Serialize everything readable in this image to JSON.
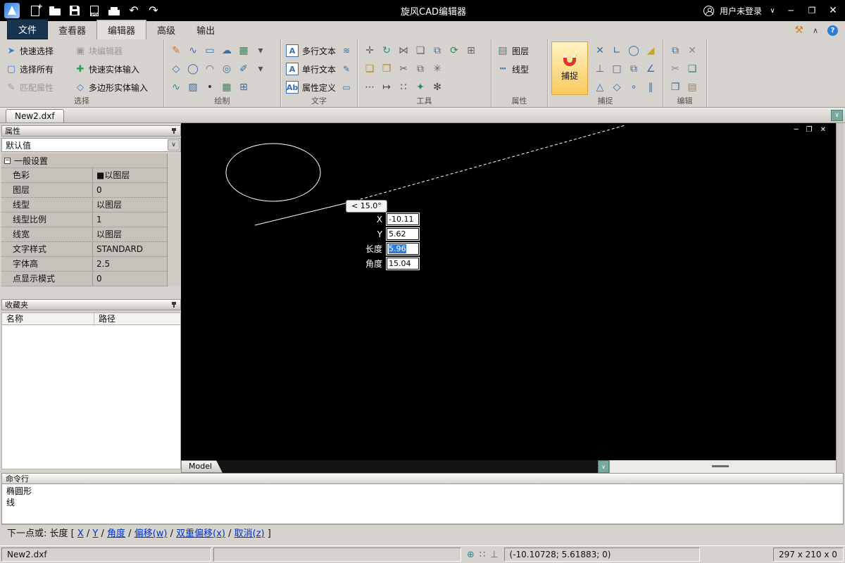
{
  "colors": {
    "titlebar_bg": "#000000",
    "chrome_bg": "#d6d3ce",
    "canvas_bg": "#000000",
    "snap_active_bg": "#fbe28a",
    "snap_active_border": "#e0a33e",
    "selection_highlight": "#2f7bd9",
    "command_link": "#0033cc",
    "file_tab_bg": "#17334e"
  },
  "glyphs": {
    "minimize": "─",
    "restore": "❐",
    "close": "✕",
    "chevron_down": "∨",
    "chevron_up": "∧",
    "undo": "↶",
    "redo": "↷",
    "plus": "+",
    "pdf": "PDF",
    "help": "?",
    "wrench": "⚒",
    "status_zoom": "⊕",
    "status_grid": "∷",
    "status_ortho": "⊥",
    "collapse_box": "−",
    "check": "✓"
  },
  "titlebar": {
    "title": "旋风CAD编辑器",
    "user_label": "用户未登录"
  },
  "menubar": {
    "tabs": [
      {
        "label": "文件"
      },
      {
        "label": "查看器"
      },
      {
        "label": "编辑器"
      },
      {
        "label": "高级"
      },
      {
        "label": "输出"
      }
    ]
  },
  "ribbon": {
    "selection": {
      "label": "选择",
      "buttons": [
        {
          "name": "quick-select-button",
          "glyph": "➤",
          "color": "#3a7bd5",
          "label": "快速选择"
        },
        {
          "name": "select-all-button",
          "glyph": "▢",
          "color": "#3a7bd5",
          "label": "选择所有"
        },
        {
          "name": "match-properties-button",
          "glyph": "✎",
          "color": "#9a9a9a",
          "label": "匹配属性",
          "disabled": true
        },
        {
          "name": "block-editor-button",
          "glyph": "▣",
          "color": "#9a9a9a",
          "label": "块编辑器",
          "disabled": true
        },
        {
          "name": "quick-entity-input-button",
          "glyph": "✚",
          "color": "#2e9e4f",
          "label": "快速实体输入"
        },
        {
          "name": "polygon-entity-input-button",
          "glyph": "◇",
          "color": "#3a7bd5",
          "label": "多边形实体输入"
        }
      ]
    },
    "draw": {
      "label": "绘制",
      "rows": [
        [
          {
            "name": "line-icon",
            "glyph": "✎",
            "color": "#c77b2f"
          },
          {
            "name": "polyline-icon",
            "glyph": "∿",
            "color": "#3a6ea5"
          },
          {
            "name": "rectangle-icon",
            "glyph": "▭",
            "color": "#3a6ea5"
          },
          {
            "name": "revcloud-icon",
            "glyph": "☁",
            "color": "#3a6ea5"
          },
          {
            "name": "insert-block-icon",
            "glyph": "▦",
            "color": "#2e8b57"
          },
          {
            "name": "draw-more-icon",
            "glyph": "▾",
            "color": "#555555"
          }
        ],
        [
          {
            "name": "polygon-icon",
            "glyph": "◇",
            "color": "#3a6ea5"
          },
          {
            "name": "circle-icon",
            "glyph": "◯",
            "color": "#3a6ea5"
          },
          {
            "name": "arc-icon",
            "glyph": "◠",
            "color": "#3a6ea5"
          },
          {
            "name": "donut-icon",
            "glyph": "◎",
            "color": "#3a6ea5"
          },
          {
            "name": "sketch-icon",
            "glyph": "✐",
            "color": "#3a6ea5"
          },
          {
            "name": "draw-options-icon",
            "glyph": "▾",
            "color": "#555555"
          }
        ],
        [
          {
            "name": "spline-icon",
            "glyph": "∿",
            "color": "#2e8b8b"
          },
          {
            "name": "hatch-icon",
            "glyph": "▨",
            "color": "#3a6ea5"
          },
          {
            "name": "point-icon",
            "glyph": "•",
            "color": "#333333"
          },
          {
            "name": "table-icon",
            "glyph": "▦",
            "color": "#2e8b57"
          },
          {
            "name": "grid-icon",
            "glyph": "⊞",
            "color": "#3a6ea5"
          }
        ]
      ]
    },
    "text": {
      "label": "文字",
      "buttons": [
        {
          "name": "mtext-button",
          "glyph": "A",
          "label": "多行文本"
        },
        {
          "name": "single-text-button",
          "glyph": "A",
          "label": "单行文本"
        },
        {
          "name": "attribute-define-button",
          "glyph": "Ab",
          "label": "属性定义"
        }
      ],
      "mini": [
        {
          "name": "text-flow-icon",
          "glyph": "≋"
        },
        {
          "name": "text-edit-icon",
          "glyph": "✎"
        },
        {
          "name": "text-box-icon",
          "glyph": "▭"
        }
      ]
    },
    "tools": {
      "label": "工具",
      "rows": [
        [
          {
            "name": "move-icon",
            "glyph": "✛",
            "color": "#666666"
          },
          {
            "name": "rotate-icon",
            "glyph": "↻",
            "color": "#2e8b8b"
          },
          {
            "name": "mirror-icon",
            "glyph": "⋈",
            "color": "#666666"
          },
          {
            "name": "draworder-icon",
            "glyph": "❏",
            "color": "#666666"
          },
          {
            "name": "copy-entity-icon",
            "glyph": "⧉",
            "color": "#3a6ea5"
          },
          {
            "name": "rotate-copy-icon",
            "glyph": "⟳",
            "color": "#2e8b57"
          },
          {
            "name": "array-icon",
            "glyph": "⊞",
            "color": "#666666"
          }
        ],
        [
          {
            "name": "make-group-icon",
            "glyph": "❏",
            "color": "#b8860b"
          },
          {
            "name": "open-group-icon",
            "glyph": "❐",
            "color": "#b8860b"
          },
          {
            "name": "cut-entity-icon",
            "glyph": "✂",
            "color": "#666666"
          },
          {
            "name": "duplicate-icon",
            "glyph": "⧉",
            "color": "#666666"
          },
          {
            "name": "explode-icon",
            "glyph": "✳",
            "color": "#666666"
          }
        ],
        [
          {
            "name": "more-tools-icon",
            "glyph": "⋯",
            "color": "#444444"
          },
          {
            "name": "measure-icon",
            "glyph": "↦",
            "color": "#444444"
          },
          {
            "name": "divide-icon",
            "glyph": "∷",
            "color": "#444444"
          },
          {
            "name": "magic-select-icon",
            "glyph": "✦",
            "color": "#2e8b57"
          },
          {
            "name": "tool-settings-icon",
            "glyph": "✻",
            "color": "#444444"
          }
        ]
      ]
    },
    "properties": {
      "label": "属性",
      "buttons": [
        {
          "name": "layers-button",
          "glyph": "▤",
          "color": "#2e8b8b",
          "label": "图层"
        },
        {
          "name": "linetype-button",
          "glyph": "┅",
          "color": "#3a6ea5",
          "label": "线型"
        }
      ]
    },
    "snap": {
      "label": "捕捉",
      "button_label": "捕捉",
      "rows": [
        [
          {
            "name": "snap-intersection-icon",
            "glyph": "✕",
            "color": "#3a6ea5"
          },
          {
            "name": "snap-endpoint-icon",
            "glyph": "∟",
            "color": "#3a6ea5"
          },
          {
            "name": "snap-center-icon",
            "glyph": "◯",
            "color": "#3a6ea5"
          },
          {
            "name": "snap-extension-icon",
            "glyph": "◢",
            "color": "#c9a227"
          }
        ],
        [
          {
            "name": "snap-perpendicular-icon",
            "glyph": "⊥",
            "color": "#3a6ea5"
          },
          {
            "name": "snap-midpoint-icon",
            "glyph": "□",
            "color": "#3a6ea5"
          },
          {
            "name": "snap-insertion-icon",
            "glyph": "⧉",
            "color": "#3a6ea5"
          },
          {
            "name": "snap-angle-icon",
            "glyph": "∠",
            "color": "#3a6ea5"
          }
        ],
        [
          {
            "name": "snap-tangent-icon",
            "glyph": "△",
            "color": "#3a6ea5"
          },
          {
            "name": "snap-quadrant-icon",
            "glyph": "◇",
            "color": "#3a6ea5"
          },
          {
            "name": "snap-nearest-icon",
            "glyph": "∘",
            "color": "#3a6ea5"
          },
          {
            "name": "snap-parallel-icon",
            "glyph": "∥",
            "color": "#3a6ea5"
          }
        ]
      ]
    },
    "edit": {
      "label": "编辑",
      "rows": [
        [
          {
            "name": "copy-icon",
            "glyph": "⧉",
            "color": "#3a6ea5"
          },
          {
            "name": "delete-icon",
            "glyph": "✕",
            "color": "#8a8a8a"
          }
        ],
        [
          {
            "name": "cut-icon",
            "glyph": "✂",
            "color": "#8a8a8a"
          },
          {
            "name": "paste-icon",
            "glyph": "❏",
            "color": "#2e8b57"
          }
        ],
        [
          {
            "name": "copy-base-icon",
            "glyph": "❐",
            "color": "#3a6ea5"
          },
          {
            "name": "paste-special-icon",
            "glyph": "▤",
            "color": "#b8860b"
          }
        ]
      ]
    }
  },
  "doctab": {
    "label": "New2.dxf"
  },
  "props_panel": {
    "title": "属性",
    "preset": "默认值",
    "section": "一般设置",
    "rows": [
      {
        "name": "色彩",
        "value": "■以图层"
      },
      {
        "name": "图层",
        "value": "0"
      },
      {
        "name": "线型",
        "value": "以图层"
      },
      {
        "name": "线型比例",
        "value": "1"
      },
      {
        "name": "线宽",
        "value": "以图层"
      },
      {
        "name": "文字样式",
        "value": "STANDARD"
      },
      {
        "name": "字体高",
        "value": "2.5"
      },
      {
        "name": "点显示模式",
        "value": "0"
      }
    ]
  },
  "fav_panel": {
    "title": "收藏夹",
    "col_name": "名称",
    "col_path": "路径"
  },
  "canvas": {
    "angle_tooltip": "< 15.0°",
    "model_tab": "Model",
    "dyn": [
      {
        "label": "X",
        "value": "-10.11"
      },
      {
        "label": "Y",
        "value": "5.62"
      },
      {
        "label": "长度",
        "value": "5.96"
      },
      {
        "label": "角度",
        "value": "15.04"
      }
    ]
  },
  "cmd": {
    "title": "命令行",
    "history": [
      {
        "text": "椭圆形"
      },
      {
        "text": "线"
      }
    ],
    "prompt": {
      "prefix": "下一点或: 长度 [ ",
      "links": [
        "X",
        "Y",
        "角度",
        "偏移(w)",
        "双重偏移(x)",
        "取消(z)"
      ],
      "sep": " / ",
      "suffix": " ]"
    }
  },
  "status": {
    "filename": "New2.dxf",
    "coords": "(-10.10728; 5.61883; 0)",
    "dims": "297 x 210 x 0"
  }
}
